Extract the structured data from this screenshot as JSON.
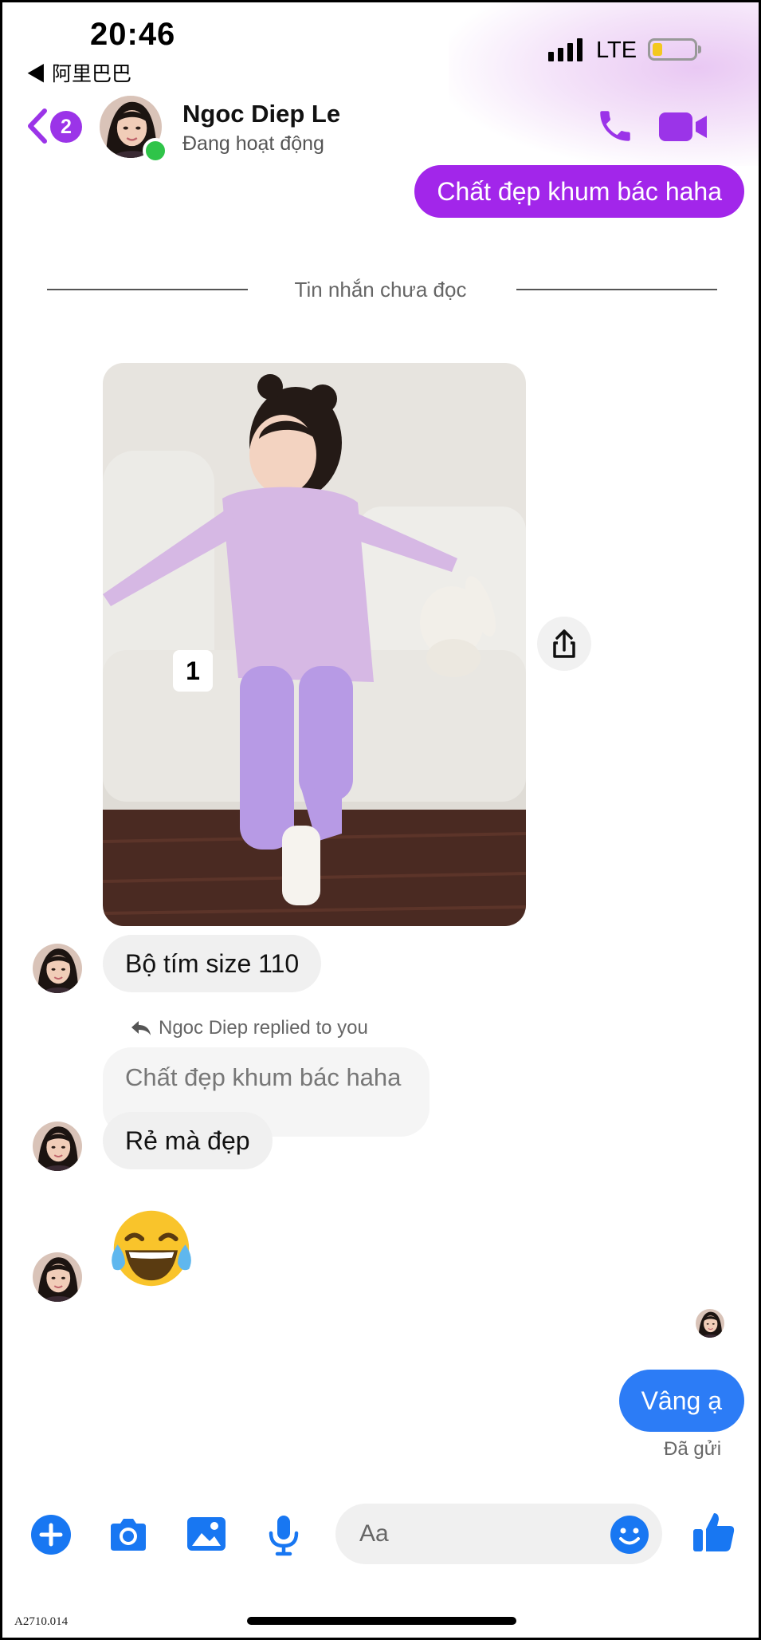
{
  "status_bar": {
    "time": "20:46",
    "back_app": "◀ 阿里巴巴",
    "network": "LTE"
  },
  "header": {
    "unread_count": "2",
    "contact_name": "Ngoc Diep Le",
    "contact_status": "Đang hoạt động",
    "accent_color": "#9b34e8"
  },
  "messages": {
    "top_outgoing": "Chất đẹp khum bác haha",
    "unread_divider": "Tin nhắn chưa đọc",
    "photo_sticker": "1",
    "incoming_1": "Bộ tím size 110",
    "replied_label": "Ngoc Diep replied to you",
    "quoted_text": "Chất đẹp khum bác haha",
    "incoming_2": "Rẻ mà đẹp",
    "emoji": "laughing-crying-emoji",
    "outgoing_last": "Vâng ạ",
    "sent_status": "Đã gửi"
  },
  "composer": {
    "placeholder": "Aa",
    "icons": [
      "plus-icon",
      "camera-icon",
      "gallery-icon",
      "microphone-icon",
      "emoji-icon",
      "thumbs-up-icon"
    ],
    "icon_color": "#1877f2"
  },
  "footer": {
    "ref_code": "A2710.014"
  }
}
